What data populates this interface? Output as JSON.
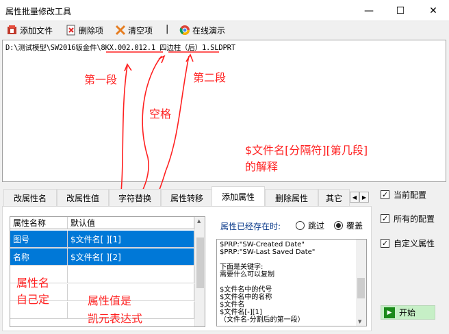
{
  "window": {
    "title": "属性批量修改工具",
    "minimize": "—",
    "maximize": "☐",
    "close": "✕"
  },
  "toolbar": {
    "add_file": "添加文件",
    "delete_item": "删除项",
    "clear_items": "清空项",
    "separator": "|",
    "online_demo": "在线演示"
  },
  "path": {
    "text": "D:\\测试模型\\SW2016钣金件\\8KX.002.012.1 四边柱（后）1.SLDPRT"
  },
  "annotations": {
    "first_segment": "第一段",
    "space": "空格",
    "second_segment": "第二段",
    "expr_line1": "$文件名[分隔符][第几段]",
    "expr_line2": "的解释",
    "prop_name_line1": "属性名",
    "prop_name_line2": "自己定",
    "prop_value_line1": "属性值是",
    "prop_value_line2": "凯元表达式",
    "color": "#ff2020"
  },
  "tabs": [
    {
      "label": "改属性名"
    },
    {
      "label": "改属性值"
    },
    {
      "label": "字符替换"
    },
    {
      "label": "属性转移"
    },
    {
      "label": "添加属性"
    },
    {
      "label": "删除属性"
    },
    {
      "label": "其它"
    }
  ],
  "active_tab": "添加属性",
  "grid": {
    "headers": [
      "属性名称",
      "默认值"
    ],
    "rows": [
      {
        "name": "图号",
        "value": "$文件名[ ][1]"
      },
      {
        "name": "名称",
        "value": "$文件名[ ][2]"
      }
    ]
  },
  "existing": {
    "label": "属性已经存在时:",
    "skip": "跳过",
    "overwrite": "覆盖",
    "selected": "覆盖"
  },
  "hint_lines": [
    "$PRP:\"SW-Created Date\"",
    "$PRP:\"SW-Last Saved Date\"",
    "",
    "下面是关键字:",
    "需要什么可以复制",
    "",
    "$文件名中的代号",
    "$文件名中的名称",
    "$文件名",
    "$文件名[-][1]",
    "（文件名-分割后的第一段）"
  ],
  "options": {
    "current_config": "当前配置",
    "all_configs": "所有的配置",
    "custom_props": "自定义属性",
    "check_mark": "✓"
  },
  "start_button": "开始",
  "colors": {
    "selection": "#0078d7",
    "start_bg": "#c6efc6",
    "label_blue": "#0a3a8a"
  }
}
